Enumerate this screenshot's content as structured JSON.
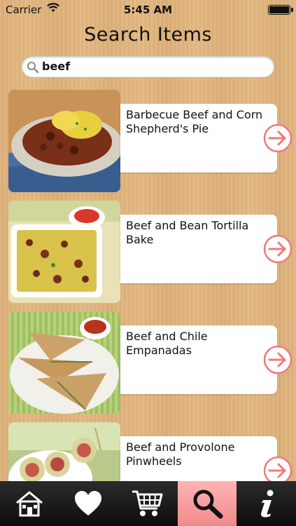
{
  "status_bar": {
    "carrier": "Carrier",
    "time": "5:45 AM",
    "battery_level": 1.0
  },
  "page": {
    "title": "Search Items"
  },
  "search": {
    "value": "beef",
    "icon": "magnifier-icon"
  },
  "results": [
    {
      "label": "Barbecue Beef and Corn Shepherd's Pie"
    },
    {
      "label": "Beef and Bean Tortilla Bake"
    },
    {
      "label": "Beef and Chile Empanadas"
    },
    {
      "label": "Beef and Provolone Pinwheels"
    }
  ],
  "tabbar": {
    "tabs": [
      {
        "icon": "home-icon"
      },
      {
        "icon": "heart-icon"
      },
      {
        "icon": "cart-icon"
      },
      {
        "icon": "search-icon",
        "active": true
      },
      {
        "icon": "info-icon"
      }
    ]
  },
  "colors": {
    "accent": "#f07a7a",
    "active_tab": "#f4a0a0",
    "tabbar": "#1a1a1a",
    "wood": "#e3b77f"
  }
}
